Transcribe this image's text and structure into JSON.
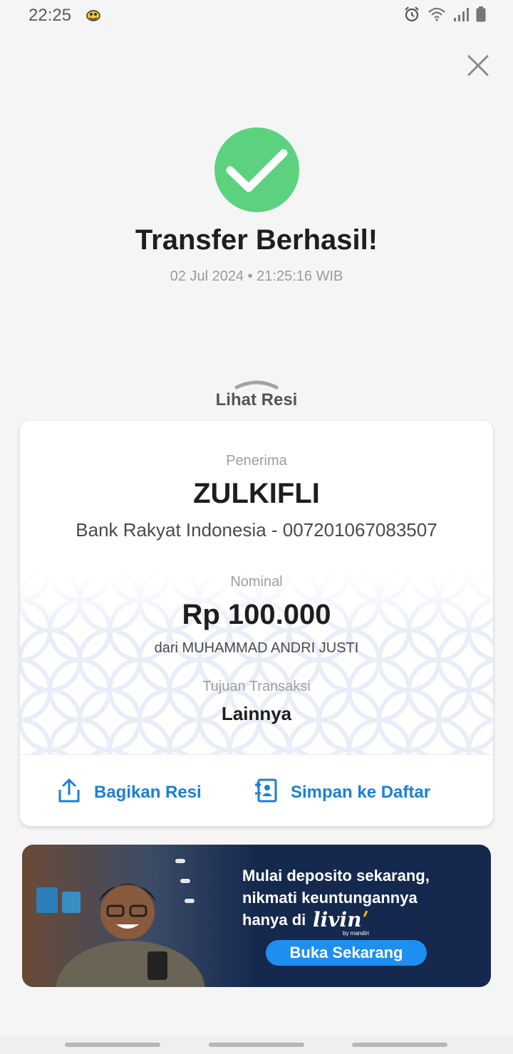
{
  "status_bar": {
    "time": "22:25",
    "icons": [
      "alarm-icon",
      "wifi-icon",
      "signal-icon",
      "battery-icon"
    ]
  },
  "header": {
    "close_icon": "close-icon"
  },
  "result": {
    "status_icon": "check-circle-icon",
    "title": "Transfer Berhasil!",
    "timestamp": "02 Jul 2024 • 21:25:16 WIB"
  },
  "receipt_toggle": {
    "label": "Lihat Resi"
  },
  "receipt": {
    "recipient_label": "Penerima",
    "recipient_name": "ZULKIFLI",
    "recipient_bank": "Bank Rakyat Indonesia - 007201067083507",
    "amount_label": "Nominal",
    "amount": "Rp 100.000",
    "sender": "dari MUHAMMAD ANDRI JUSTI",
    "purpose_label": "Tujuan Transaksi",
    "purpose": "Lainnya",
    "actions": {
      "share_label": "Bagikan Resi",
      "save_label": "Simpan ke Daftar"
    }
  },
  "banner": {
    "line1": "Mulai deposito sekarang,",
    "line2": "nikmati keuntungannya",
    "line3": "hanya di",
    "brand": "livin' by mandiri",
    "cta": "Buka Sekarang"
  },
  "colors": {
    "success": "#5cd27e",
    "accent": "#1b7fd8",
    "banner_bg": "#15294f",
    "cta": "#1e8ff0"
  }
}
